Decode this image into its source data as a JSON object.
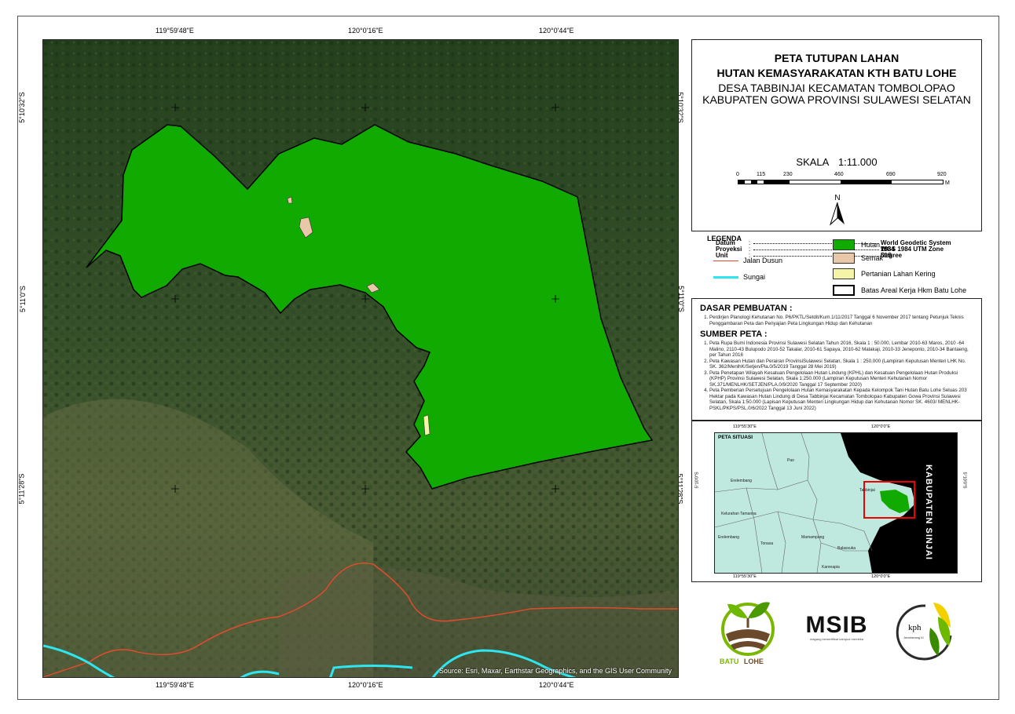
{
  "map": {
    "top_coords": [
      "119°59'48\"E",
      "120°0'16\"E",
      "120°0'44\"E"
    ],
    "bottom_coords": [
      "119°59'48\"E",
      "120°0'16\"E",
      "120°0'44\"E"
    ],
    "left_coords": [
      "5°10'32\"S",
      "5°11'0\"S",
      "5°11'28\"S"
    ],
    "right_coords": [
      "5°10'32\"S",
      "5°11'0\"S",
      "5°11'28\"S"
    ],
    "attribution": "Source: Esri, Maxar, Earthstar Geographics, and the GIS User Community",
    "colors": {
      "hutan": "#11aa00",
      "semak": "#e8c8a8",
      "pertanian": "#f5f5a8",
      "jalan": "#e84a2c",
      "sungai": "#2ee6f0"
    }
  },
  "title": {
    "line1": "PETA TUTUPAN LAHAN",
    "line2": "HUTAN KEMASYARAKATAN KTH BATU LOHE",
    "line3": "DESA TABBINJAI KECAMATAN TOMBOLOPAO",
    "line4": "KABUPATEN GOWA PROVINSI SULAWESI SELATAN",
    "skala_label": "SKALA",
    "skala_value": "1:11.000",
    "scale_ticks": [
      "0",
      "115",
      "230",
      "460",
      "690",
      "920"
    ],
    "scale_unit": "M",
    "north": "N"
  },
  "meta": {
    "datum_key": "Datum",
    "datum_value": "World Geodetic System 1984",
    "proyeksi_key": "Proyeksi",
    "proyeksi_value": "WGS 1984 UTM Zone 51S",
    "unit_key": "Unit",
    "unit_value": "Degree"
  },
  "legend": {
    "title": "LEGENDA",
    "jalan": "Jalan Dusun",
    "sungai": "Sungai",
    "hutan": "Hutan",
    "semak": "Semak",
    "pertanian": "Pertanian Lahan Kering",
    "batas": "Batas Areal Kerja Hkm Batu Lohe"
  },
  "dasar": {
    "heading": "DASAR PEMBUATAN :",
    "items": [
      "Perdirjen Planologi Kehutanan No. P6/PKTL/Setdit/Kum.1/11/2017 Tanggal 6 November 2017 tentang Petunjuk Teknis Penggambaran Peta dan Penyajian Peta Lingkungan Hidup dan Kehutanan"
    ],
    "sumber_heading": "SUMBER PETA :",
    "sumber_items": [
      "Peta Rupa Bumi Indonesia Provinsi Sulawesi Selatan Tahun 2016, Skala 1 : 50.000, Lembar 2010-63 Maros, 2010 -64 Malino, 2110-43 Bulupodo 2010-52 Takalar, 2010-61 Sapaya, 2010-62 Malakaji, 2010-33 Jeneponto, 2010-34 Bantaeng, per Tahun 2016",
      "Peta Kawasan Hutan dan Perairan ProvinsiSulawesi Selatan, Skala 1 : 250.000 (Lampiran Keputusan Menteri LHK No. SK. 362/MenlhK/Setjen/Pla.0/5/2019 Tanggal 28 Mei 2019)",
      "Peta Penetapan Wilayah Kesatuan Pengelolaan Hutan Lindung (KPHL) dan Kesatuan Pengelolaan Hutan Produksi (KPHP) Provinsi Sulawesi Selatan, Skala 1:250.000 (Lampiran Keputusan Menteri Kehutanan Nomor SK.371/MENLHK/SETJEN/PLA.0/9/2020 Tanggal 17 September 2020)",
      "Peta Pemberian Persetujuan Pengelolaan Hutan Kemasyarakatan Kepada Kelompok Tani Hutan Batu Lohe Seluas 203 Hektar pada Kawasan Hutan Lindung di Desa Tabbinjai Kecamatan Tombolopao Kabupaten Gowa Provinsi Sulawesi Selatan, Skala 1:50.000 (Lapisan Keputusan Menteri Lingkungan Hidup dan Kehutanan Nomor SK. 4603/ MENLHK-PSKL/PKPS/PSL.0/6/2022 Tanggal 13 Juni 2022)"
    ]
  },
  "inset": {
    "title": "PETA SITUASI",
    "top_coords": [
      "119°55'30\"E",
      "120°0'0\"E"
    ],
    "bottom_coords": [
      "119°55'30\"E",
      "120°0'0\"E"
    ],
    "left_coord": "5°10'0\"S",
    "right_coord": "5°10'0\"S",
    "regency": "KABUPATEN SINJAI",
    "places": [
      "Pao",
      "Erelembang",
      "Tabbinjai",
      "Kelurahan Tamaona",
      "Erelembang",
      "Tonasa",
      "Mamampang",
      "Balassuka",
      "Kanreapia"
    ]
  },
  "logos": {
    "batu": "BATU",
    "lohe": "LOHE",
    "msib": "MSIB",
    "msib_tag": "magang bersertifikat kampus merdeka",
    "kph": "kph",
    "kph_sub": "Jeneberang III"
  }
}
